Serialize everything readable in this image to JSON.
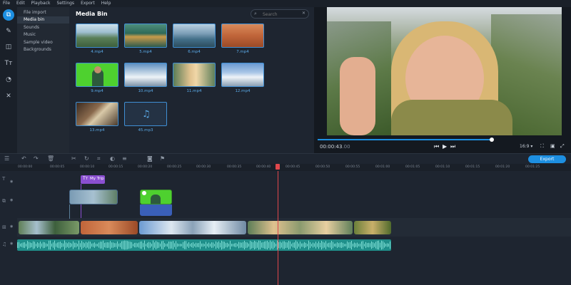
{
  "menu": [
    "File",
    "Edit",
    "Playback",
    "Settings",
    "Export",
    "Help"
  ],
  "sidebar": {
    "items": [
      {
        "label": "File import"
      },
      {
        "label": "Media bin"
      },
      {
        "label": "Sounds"
      },
      {
        "label": "Music"
      },
      {
        "label": "Sample video"
      },
      {
        "label": "Backgrounds"
      }
    ]
  },
  "bin": {
    "title": "Media Bin",
    "search_placeholder": "Search",
    "items": [
      {
        "label": "4.mp4"
      },
      {
        "label": "5.mp4"
      },
      {
        "label": "6.mp4"
      },
      {
        "label": "7.mp4"
      },
      {
        "label": "9.mp4"
      },
      {
        "label": "10.mp4"
      },
      {
        "label": "11.mp4"
      },
      {
        "label": "12.mp4"
      },
      {
        "label": "13.mp4"
      },
      {
        "label": "45.mp3"
      }
    ]
  },
  "preview": {
    "time_current": "00:00:43",
    "time_rest": ".00",
    "progress": 1.0,
    "aspect_ratio": "16:9 ▾"
  },
  "timeline": {
    "export_label": "Export",
    "ruler": [
      "00:00:00",
      "00:00:05",
      "00:00:10",
      "00:00:15",
      "00:00:20",
      "00:00:25",
      "00:00:30",
      "00:00:35",
      "00:00:40",
      "00:00:45",
      "00:00:50",
      "00:00:55",
      "00:01:00",
      "00:01:05",
      "00:01:10",
      "00:01:15",
      "00:01:20",
      "00:01:25"
    ],
    "title_clip": "My Trip"
  },
  "colors": {
    "accent": "#1d8fe1",
    "playhead": "#e0474c",
    "title_clip": "#8a4fd1",
    "audio": "#1f8f8a"
  }
}
